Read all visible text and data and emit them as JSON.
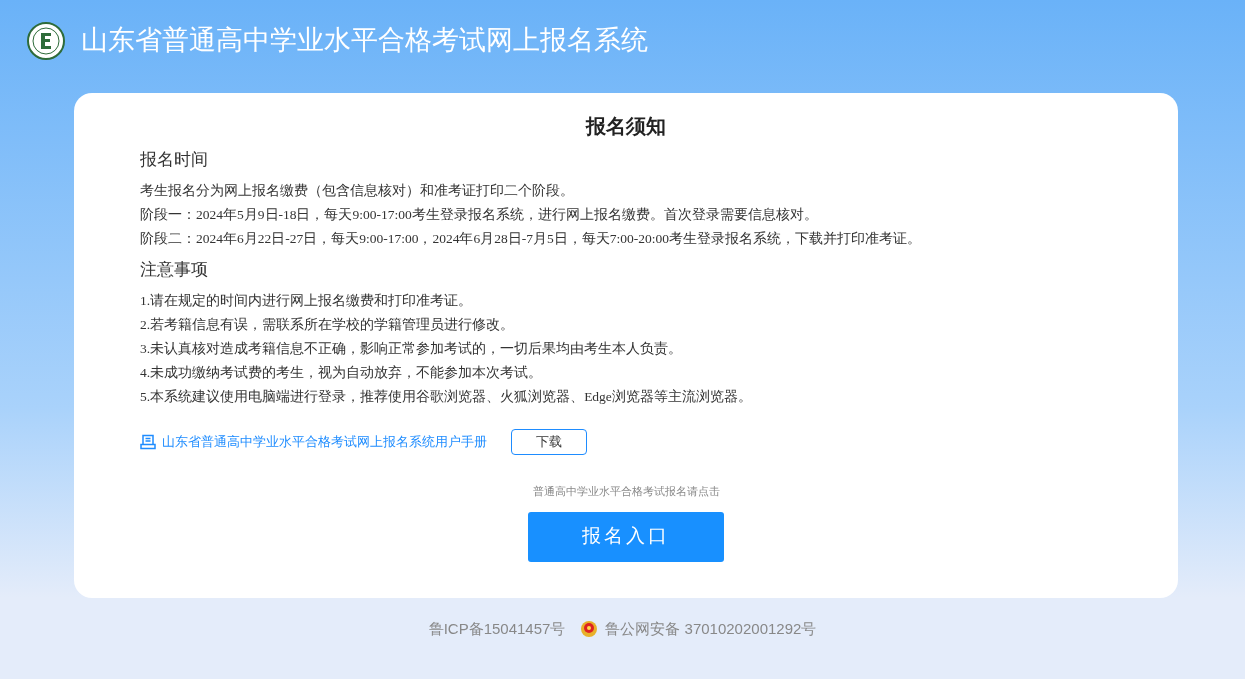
{
  "header": {
    "title": "山东省普通高中学业水平合格考试网上报名系统"
  },
  "notice": {
    "title": "报名须知",
    "sections": [
      {
        "heading": "报名时间",
        "lines": [
          "考生报名分为网上报名缴费（包含信息核对）和准考证打印二个阶段。",
          "阶段一：2024年5月9日-18日，每天9:00-17:00考生登录报名系统，进行网上报名缴费。首次登录需要信息核对。",
          "阶段二：2024年6月22日-27日，每天9:00-17:00，2024年6月28日-7月5日，每天7:00-20:00考生登录报名系统，下载并打印准考证。"
        ]
      },
      {
        "heading": "注意事项",
        "lines": [
          "1.请在规定的时间内进行网上报名缴费和打印准考证。",
          "2.若考籍信息有误，需联系所在学校的学籍管理员进行修改。",
          "3.未认真核对造成考籍信息不正确，影响正常参加考试的，一切后果均由考生本人负责。",
          "4.未成功缴纳考试费的考生，视为自动放弃，不能参加本次考试。",
          "5.本系统建议使用电脑端进行登录，推荐使用谷歌浏览器、火狐浏览器、Edge浏览器等主流浏览器。"
        ]
      }
    ],
    "manual": {
      "link": "山东省普通高中学业水平合格考试网上报名系统用户手册",
      "button": "下载"
    },
    "hint": "普通高中学业水平合格考试报名请点击",
    "entry_button": "报名入口"
  },
  "footer": {
    "icp": "鲁ICP备15041457号",
    "police": "鲁公网安备 37010202001292号"
  }
}
